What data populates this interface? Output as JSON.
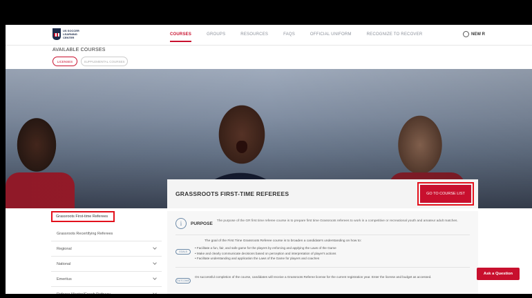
{
  "logo": {
    "text": "US SOCCER LEARNING CENTER"
  },
  "nav": {
    "items": [
      {
        "label": "COURSES",
        "active": true
      },
      {
        "label": "GROUPS",
        "active": false
      },
      {
        "label": "RESOURCES",
        "active": false
      },
      {
        "label": "FAQS",
        "active": false
      },
      {
        "label": "OFFICIAL UNIFORM",
        "active": false
      },
      {
        "label": "RECOGNIZE TO RECOVER",
        "active": false
      }
    ],
    "user_label": "NEW R",
    "user_icon": "user-circle-icon"
  },
  "available_courses": {
    "heading": "AVAILABLE COURSES",
    "pills": [
      {
        "label": "LICENSES",
        "active": true
      },
      {
        "label": "SUPPLEMENTAL COURSES",
        "active": false
      }
    ]
  },
  "course": {
    "title": "GRASSROOTS FIRST-TIME REFEREES",
    "go_button": "GO TO COURSE LIST"
  },
  "sidebar": {
    "items": [
      {
        "label": "Grassroots First-time Referees",
        "active": true,
        "expandable": false
      },
      {
        "label": "Grassroots Recertifying Referees",
        "active": false,
        "expandable": false
      },
      {
        "label": "Regional",
        "active": false,
        "expandable": true
      },
      {
        "label": "National",
        "active": false,
        "expandable": true
      },
      {
        "label": "Emeritus",
        "active": false,
        "expandable": true
      },
      {
        "label": "Referee Mentor/Coach Pathway",
        "active": false,
        "expandable": true
      }
    ]
  },
  "content": {
    "purpose_label": "PURPOSE",
    "purpose_text": "The purpose of the GR first time referee course is to prepare first time Grassroots referees to work in a competitive or recreational youth and amateur adult matches.",
    "goal_intro": "The goal of the First Time Grassroots Referee course is to broaden a candidate's understanding on how to:",
    "goals_tag": "GOALS",
    "goals": [
      "Facilitate a fun, fair, and safe game for the players by enforcing and applying the Laws of the Game",
      "Make and clearly communicate decisions based on perception and interpretation of player's actions",
      "Facilitate understanding and application the Laws of the Game for players and coaches"
    ],
    "outcome_tag": "OUTCOME",
    "outcome_text": "On successful completion of the course, candidates will receive a Grassroots Referee license for the current registration year. Enter the license and budget as accessed."
  },
  "ask_button": "Ask a Question",
  "colors": {
    "accent": "#c8102e",
    "navy": "#1b2a4a"
  }
}
